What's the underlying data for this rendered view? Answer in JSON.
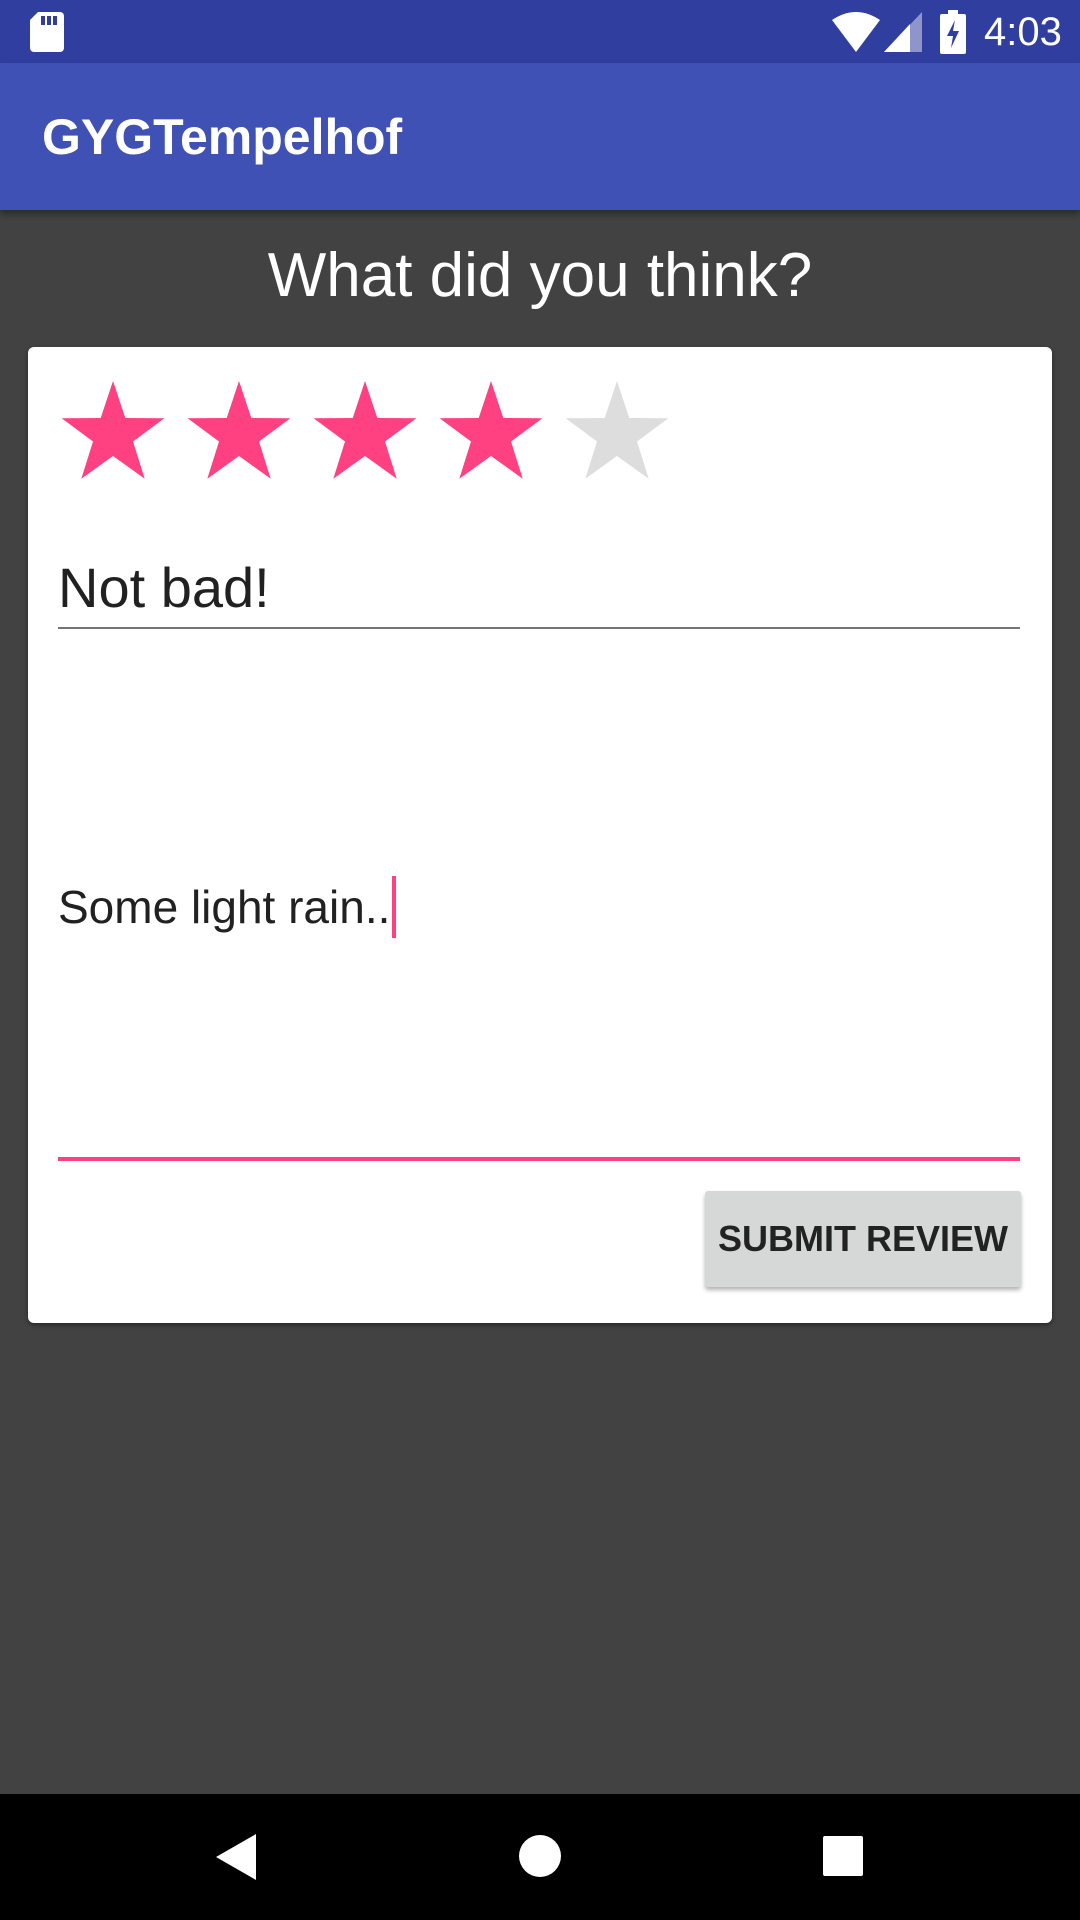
{
  "status_bar": {
    "time": "4:03",
    "icons": [
      "sd-card-icon",
      "wifi-icon",
      "cell-signal-icon",
      "battery-charging-icon"
    ]
  },
  "app_bar": {
    "title": "GYGTempelhof"
  },
  "prompt": {
    "heading": "What did you think?"
  },
  "review": {
    "rating": 4,
    "max_rating": 5,
    "title_value": "Not bad!",
    "body_value": "Some light rain..",
    "submit_label": "SUBMIT REVIEW"
  },
  "nav_bar": {
    "icons": [
      "back-icon",
      "home-icon",
      "recents-icon"
    ]
  },
  "colors": {
    "status_bar": "#303F9F",
    "app_bar": "#3F51B5",
    "background": "#424242",
    "accent": "#FF4081",
    "star_filled": "#FF4081",
    "star_empty": "#DDDDDD",
    "button": "#D6D7D7"
  }
}
